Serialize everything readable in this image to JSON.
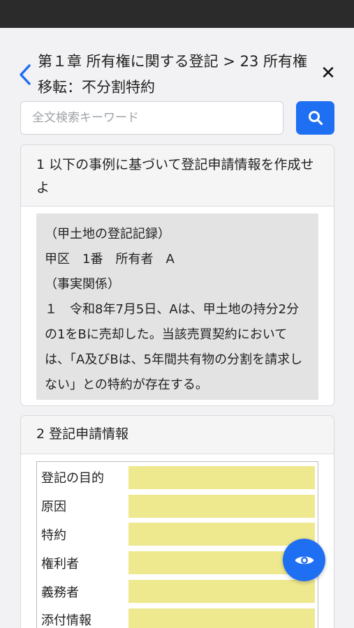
{
  "header": {
    "title": "第１章 所有権に関する登記 > 23 所有権移転：不分割特約",
    "close_symbol": "✕"
  },
  "search": {
    "placeholder": "全文検索キーワード",
    "value": ""
  },
  "section1": {
    "title": "1 以下の事例に基づいて登記申請情報を作成せよ",
    "case_lines": [
      "（甲土地の登記記録）",
      "甲区　1番　所有者　A",
      "（事実関係）",
      "１　令和8年7月5日、Aは、甲土地の持分2分の1をBに売却した。当該売買契約においては、「A及びBは、5年間共有物の分割を請求しない」との特約が存在する。"
    ]
  },
  "section2": {
    "title": "2 登記申請情報",
    "rows": [
      {
        "label": "登記の目的"
      },
      {
        "label": "原因"
      },
      {
        "label": "特約"
      },
      {
        "label": "権利者"
      },
      {
        "label": "義務者"
      },
      {
        "label": "添付情報"
      }
    ]
  },
  "colors": {
    "accent": "#1f6ff2",
    "answer_field": "#eee88e",
    "case_background": "#e3e3e3",
    "status_bar": "#2b2b2b"
  },
  "icons": {
    "back": "chevron-left-icon",
    "close": "close-icon",
    "search": "search-icon",
    "reveal": "eye-icon"
  }
}
